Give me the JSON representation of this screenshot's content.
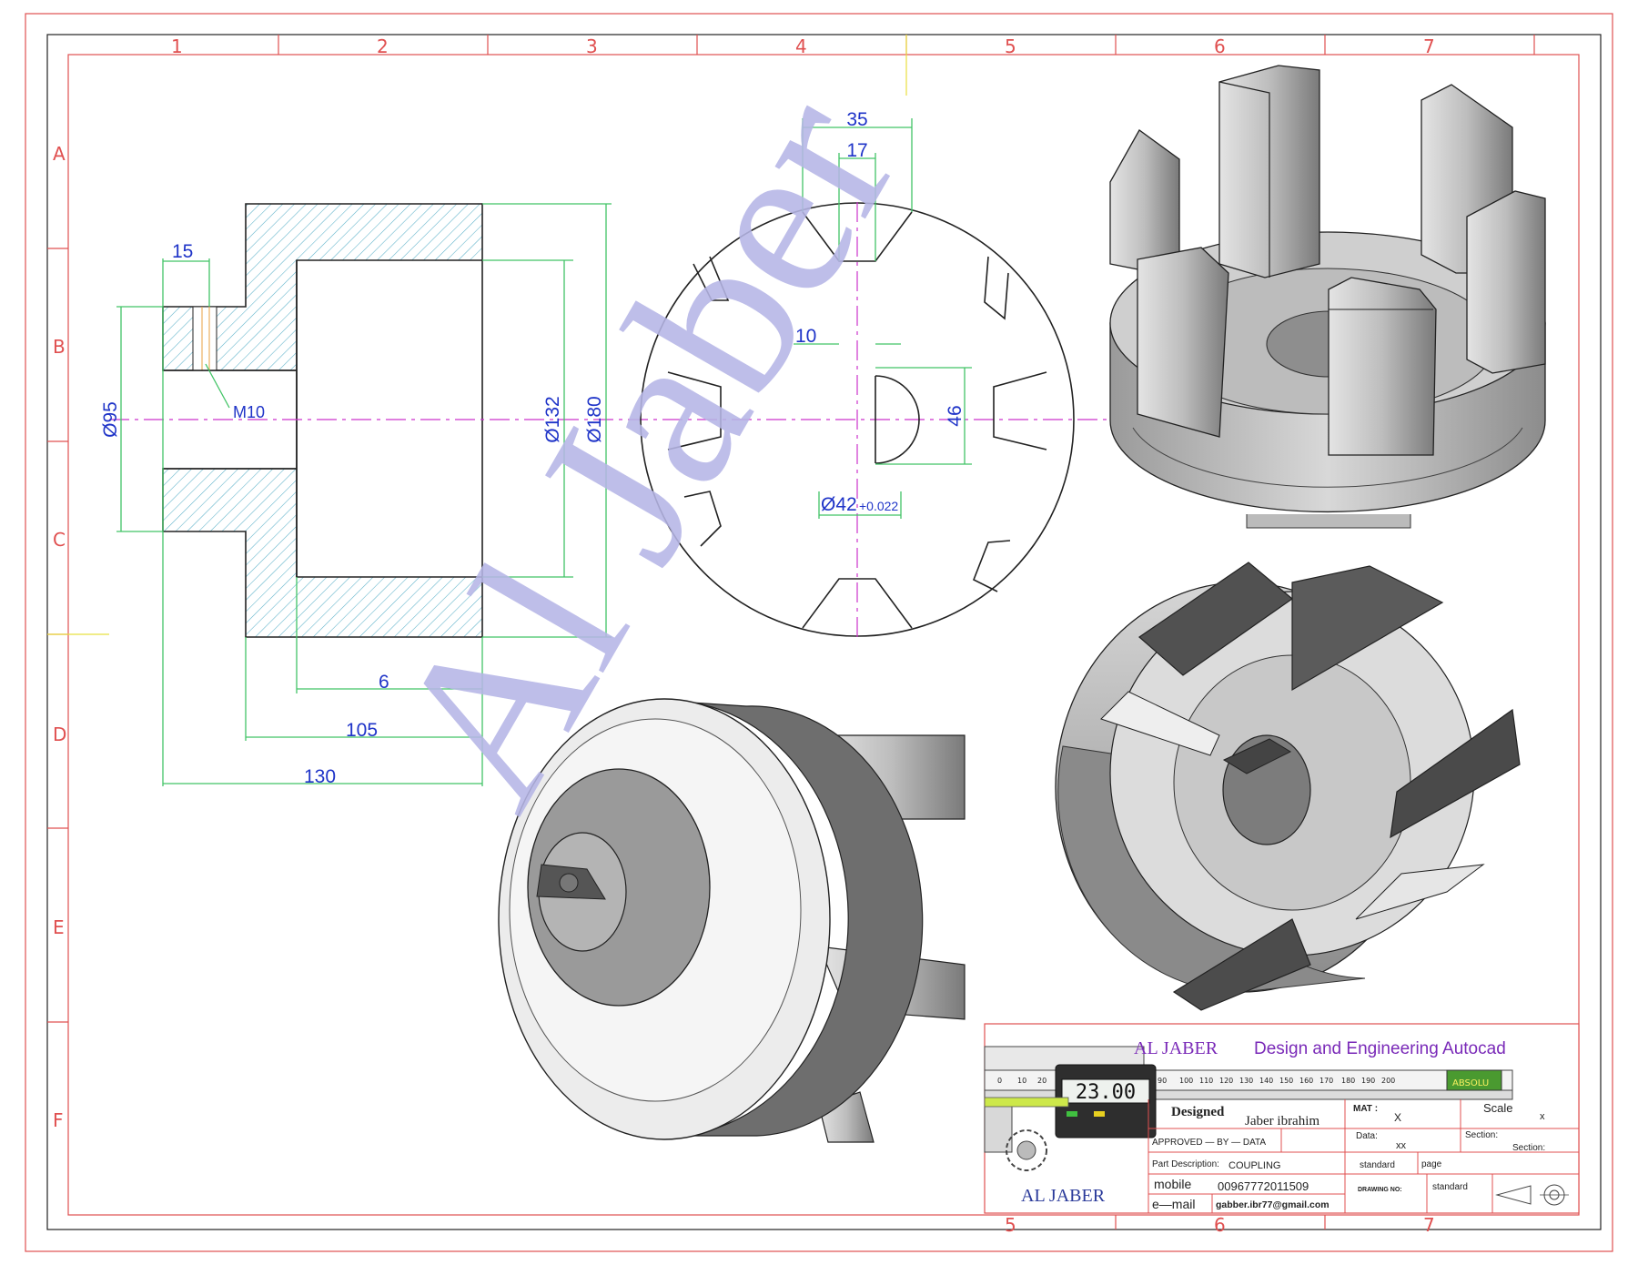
{
  "grid": {
    "top_numbers": [
      "1",
      "2",
      "3",
      "4",
      "5",
      "6",
      "7"
    ],
    "bottom_numbers": [
      "5",
      "6",
      "7"
    ],
    "side_letters": [
      "A",
      "B",
      "C",
      "D",
      "E",
      "F"
    ]
  },
  "watermark": "Al Jaber",
  "section_view": {
    "dims": {
      "d15": "15",
      "m10": "M10",
      "d95": "Ø95",
      "d132": "Ø132",
      "d180": "Ø180",
      "d6": "6",
      "d105": "105",
      "d130": "130"
    }
  },
  "front_view": {
    "dims": {
      "d35": "35",
      "d17": "17",
      "d10": "10",
      "d46": "46",
      "d42": "Ø42",
      "tol": "+0.022"
    }
  },
  "title_block": {
    "company_heading": "AL JABER",
    "heading_rest": "Design and Engineering Autocad",
    "caliper_reading": "23.00",
    "caliper_scale": [
      "0",
      "10",
      "20",
      "90",
      "100",
      "110",
      "120",
      "130",
      "140",
      "150",
      "160",
      "170",
      "180",
      "190",
      "200"
    ],
    "caliper_brand": "ABSOLU",
    "logo_text": "AL JABER",
    "designed_label": "Designed",
    "designer": "Jaber ibrahim",
    "approved": "APPROVED — BY — DATA",
    "part_desc_label": "Part Description:",
    "part_desc": "COUPLING",
    "mobile_label": "mobile",
    "mobile": "00967772011509",
    "email_label": "e—mail",
    "email": "gabber.ibr77@gmail.com",
    "mat_label": "MAT :",
    "mat": "X",
    "scale_label": "Scale",
    "scale": "x",
    "data_label": "Data:",
    "data": "xx",
    "section_label": "Section:",
    "section_value": "Section:",
    "standard1": "standard",
    "page_label": "page",
    "drawing_no_label": "DRAWING NO:",
    "standard2": "standard"
  }
}
